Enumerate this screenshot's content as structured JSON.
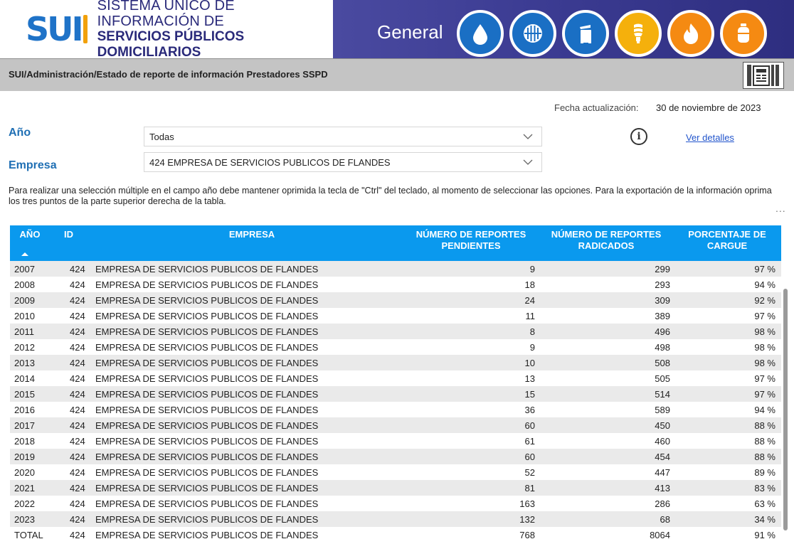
{
  "brand": {
    "logo_letters": "SUI",
    "logo_line1": "SISTEMA ÚNICO DE INFORMACIÓN DE",
    "logo_line2": "SERVICIOS PÚBLICOS DOMICILIARIOS",
    "section_label": "General"
  },
  "service_icons": [
    {
      "name": "water-drop-icon",
      "color": "#1a6fc4"
    },
    {
      "name": "sewer-grate-icon",
      "color": "#1a6fc4"
    },
    {
      "name": "trash-bin-icon",
      "color": "#1a6fc4"
    },
    {
      "name": "lightbulb-icon",
      "color": "#f5b00c"
    },
    {
      "name": "flame-icon",
      "color": "#f58a12"
    },
    {
      "name": "gas-cylinder-icon",
      "color": "#f58a12"
    }
  ],
  "breadcrumb": "SUI/Administración/Estado de reporte de información Prestadores SSPD",
  "update": {
    "label": "Fecha actualización:",
    "value": "30 de noviembre de 2023"
  },
  "filters": {
    "year_label": "Año",
    "year_value": "Todas",
    "company_label": "Empresa",
    "company_value": "424 EMPRESA DE SERVICIOS PUBLICOS DE FLANDES"
  },
  "details_link": "Ver detalles",
  "help_text": "Para realizar una selección múltiple en el campo año debe mantener oprimida la tecla de \"Ctrl\" del teclado, al momento de seleccionar las opciones. Para la exportación de la información oprima los tres puntos de la parte superior derecha de la tabla.",
  "more_options": "...",
  "table": {
    "headers": {
      "year": "AÑO",
      "id": "ID",
      "company": "EMPRESA",
      "pending": "NÚMERO DE REPORTES PENDIENTES",
      "filed": "NÚMERO DE REPORTES RADICADOS",
      "percent": "PORCENTAJE DE CARGUE"
    },
    "rows": [
      {
        "year": "2007",
        "id": "424",
        "company": "EMPRESA DE SERVICIOS PUBLICOS DE FLANDES",
        "pending": "9",
        "filed": "299",
        "percent": "97 %"
      },
      {
        "year": "2008",
        "id": "424",
        "company": "EMPRESA DE SERVICIOS PUBLICOS DE FLANDES",
        "pending": "18",
        "filed": "293",
        "percent": "94 %"
      },
      {
        "year": "2009",
        "id": "424",
        "company": "EMPRESA DE SERVICIOS PUBLICOS DE FLANDES",
        "pending": "24",
        "filed": "309",
        "percent": "92 %"
      },
      {
        "year": "2010",
        "id": "424",
        "company": "EMPRESA DE SERVICIOS PUBLICOS DE FLANDES",
        "pending": "11",
        "filed": "389",
        "percent": "97 %"
      },
      {
        "year": "2011",
        "id": "424",
        "company": "EMPRESA DE SERVICIOS PUBLICOS DE FLANDES",
        "pending": "8",
        "filed": "496",
        "percent": "98 %"
      },
      {
        "year": "2012",
        "id": "424",
        "company": "EMPRESA DE SERVICIOS PUBLICOS DE FLANDES",
        "pending": "9",
        "filed": "498",
        "percent": "98 %"
      },
      {
        "year": "2013",
        "id": "424",
        "company": "EMPRESA DE SERVICIOS PUBLICOS DE FLANDES",
        "pending": "10",
        "filed": "508",
        "percent": "98 %"
      },
      {
        "year": "2014",
        "id": "424",
        "company": "EMPRESA DE SERVICIOS PUBLICOS DE FLANDES",
        "pending": "13",
        "filed": "505",
        "percent": "97 %"
      },
      {
        "year": "2015",
        "id": "424",
        "company": "EMPRESA DE SERVICIOS PUBLICOS DE FLANDES",
        "pending": "15",
        "filed": "514",
        "percent": "97 %"
      },
      {
        "year": "2016",
        "id": "424",
        "company": "EMPRESA DE SERVICIOS PUBLICOS DE FLANDES",
        "pending": "36",
        "filed": "589",
        "percent": "94 %"
      },
      {
        "year": "2017",
        "id": "424",
        "company": "EMPRESA DE SERVICIOS PUBLICOS DE FLANDES",
        "pending": "60",
        "filed": "450",
        "percent": "88 %"
      },
      {
        "year": "2018",
        "id": "424",
        "company": "EMPRESA DE SERVICIOS PUBLICOS DE FLANDES",
        "pending": "61",
        "filed": "460",
        "percent": "88 %"
      },
      {
        "year": "2019",
        "id": "424",
        "company": "EMPRESA DE SERVICIOS PUBLICOS DE FLANDES",
        "pending": "60",
        "filed": "454",
        "percent": "88 %"
      },
      {
        "year": "2020",
        "id": "424",
        "company": "EMPRESA DE SERVICIOS PUBLICOS DE FLANDES",
        "pending": "52",
        "filed": "447",
        "percent": "89 %"
      },
      {
        "year": "2021",
        "id": "424",
        "company": "EMPRESA DE SERVICIOS PUBLICOS DE FLANDES",
        "pending": "81",
        "filed": "413",
        "percent": "83 %"
      },
      {
        "year": "2022",
        "id": "424",
        "company": "EMPRESA DE SERVICIOS PUBLICOS DE FLANDES",
        "pending": "163",
        "filed": "286",
        "percent": "63 %"
      },
      {
        "year": "2023",
        "id": "424",
        "company": "EMPRESA DE SERVICIOS PUBLICOS DE FLANDES",
        "pending": "132",
        "filed": "68",
        "percent": "34 %"
      },
      {
        "year": "TOTAL",
        "id": "424",
        "company": "EMPRESA DE SERVICIOS PUBLICOS DE FLANDES",
        "pending": "768",
        "filed": "8064",
        "percent": "91 %"
      }
    ]
  }
}
